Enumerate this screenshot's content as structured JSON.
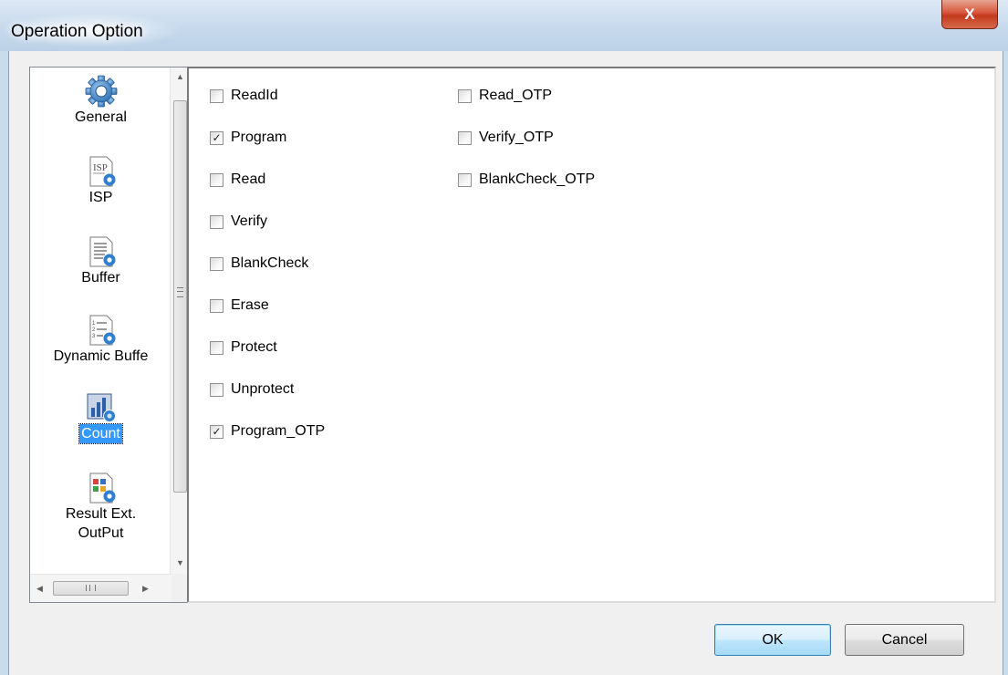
{
  "window": {
    "title": "Operation Option",
    "close_label": "X"
  },
  "nav": {
    "items": [
      {
        "label": "General",
        "icon": "gear-icon"
      },
      {
        "label": "ISP",
        "icon": "isp-icon"
      },
      {
        "label": "Buffer",
        "icon": "buffer-icon"
      },
      {
        "label": "Dynamic Buffe",
        "icon": "dynamic-buffer-icon"
      },
      {
        "label": "Count",
        "icon": "count-chart-icon",
        "selected": true
      },
      {
        "label": "Result Ext.",
        "label2": "OutPut",
        "icon": "result-output-icon"
      }
    ],
    "scroll_grip": "III"
  },
  "options": {
    "col1": [
      {
        "label": "ReadId",
        "checked": false
      },
      {
        "label": "Program",
        "checked": true
      },
      {
        "label": "Read",
        "checked": false
      },
      {
        "label": "Verify",
        "checked": false
      },
      {
        "label": "BlankCheck",
        "checked": false
      },
      {
        "label": "Erase",
        "checked": false
      },
      {
        "label": "Protect",
        "checked": false
      },
      {
        "label": "Unprotect",
        "checked": false
      },
      {
        "label": "Program_OTP",
        "checked": true
      }
    ],
    "col2": [
      {
        "label": "Read_OTP",
        "checked": false
      },
      {
        "label": "Verify_OTP",
        "checked": false
      },
      {
        "label": "BlankCheck_OTP",
        "checked": false
      }
    ]
  },
  "buttons": {
    "ok": "OK",
    "cancel": "Cancel"
  },
  "colors": {
    "selection": "#3399ff",
    "accent_icon": "#3a7fc4"
  }
}
